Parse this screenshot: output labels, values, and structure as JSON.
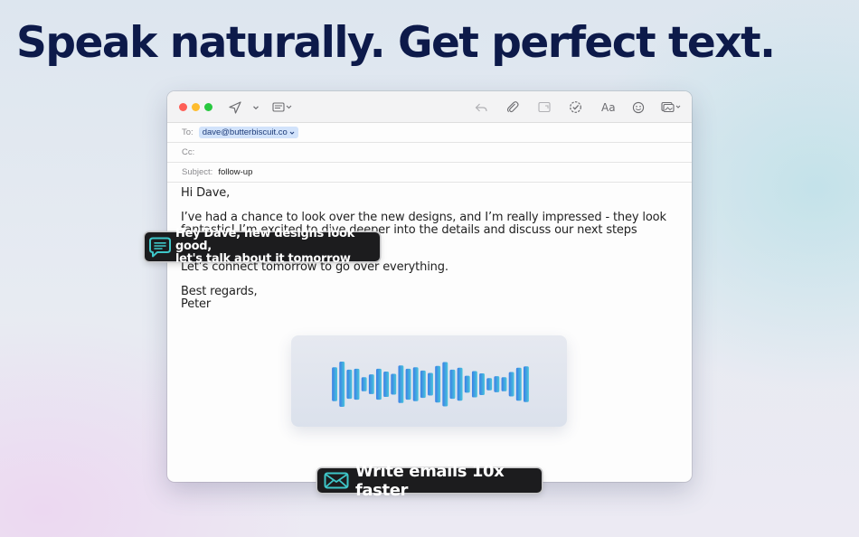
{
  "headline": "Speak naturally. Get perfect text.",
  "toolbar": {
    "icons": [
      "send-icon",
      "chevron-down-icon",
      "header-fields-icon",
      "reply-icon",
      "attachment-icon",
      "markup-icon",
      "format-check-icon",
      "font-icon",
      "emoji-icon",
      "photo-browser-icon"
    ],
    "font_label": "Aa"
  },
  "email": {
    "to_label": "To:",
    "to_value": "dave@butterbiscuit.co",
    "cc_label": "Cc:",
    "subject_label": "Subject:",
    "subject_value": "follow-up",
    "greeting": "Hi Dave,",
    "paragraph1": "I’ve had a chance to look over the new designs, and I’m really impressed - they look fantastic! I’m excited to dive deeper into the details and discuss our next steps together.",
    "paragraph2": "Let’s connect tomorrow to go over everything.",
    "closing": "Best regards,",
    "signature": "Peter"
  },
  "transcript": {
    "line1": "Hey Dave, new designs look good,",
    "line2": "let's talk about it tomorrow"
  },
  "badge": {
    "label": "Write emails 10x faster"
  },
  "colors": {
    "headline": "#0d1a4a",
    "accent_teal": "#3ec6c8",
    "wave_start": "#3b7fe6",
    "wave_end": "#48c4dc",
    "pill_bg": "#1c1c1e"
  },
  "waveform": {
    "levels": [
      0.72,
      0.96,
      0.62,
      0.66,
      0.3,
      0.42,
      0.66,
      0.54,
      0.44,
      0.8,
      0.66,
      0.72,
      0.58,
      0.48,
      0.78,
      0.94,
      0.62,
      0.7,
      0.36,
      0.56,
      0.46,
      0.26,
      0.34,
      0.3,
      0.52,
      0.7,
      0.76
    ]
  }
}
